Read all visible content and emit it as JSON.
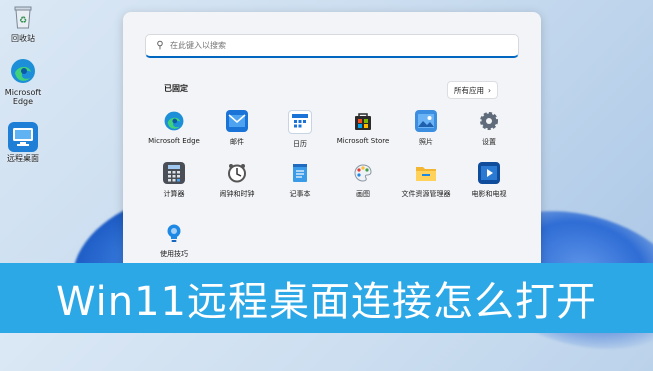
{
  "desktop": {
    "icons": [
      {
        "label": "回收站",
        "icon": "recycle-bin-icon"
      },
      {
        "label": "Microsoft Edge",
        "icon": "edge-icon"
      },
      {
        "label": "远程桌面",
        "icon": "remote-desktop-icon"
      }
    ]
  },
  "start_menu": {
    "search_placeholder": "在此键入以搜索",
    "pinned_title": "已固定",
    "all_apps_label": "所有应用",
    "apps": [
      {
        "label": "Microsoft Edge",
        "icon": "edge-icon"
      },
      {
        "label": "邮件",
        "icon": "mail-icon"
      },
      {
        "label": "日历",
        "icon": "calendar-icon"
      },
      {
        "label": "Microsoft Store",
        "icon": "store-icon"
      },
      {
        "label": "照片",
        "icon": "photos-icon"
      },
      {
        "label": "设置",
        "icon": "settings-icon"
      },
      {
        "label": "计算器",
        "icon": "calculator-icon"
      },
      {
        "label": "闹钟和时钟",
        "icon": "clock-icon"
      },
      {
        "label": "记事本",
        "icon": "notepad-icon"
      },
      {
        "label": "画图",
        "icon": "paint-icon"
      },
      {
        "label": "文件资源管理器",
        "icon": "file-explorer-icon"
      },
      {
        "label": "电影和电视",
        "icon": "movies-tv-icon"
      },
      {
        "label": "使用技巧",
        "icon": "tips-icon"
      }
    ]
  },
  "banner": {
    "text": "Win11远程桌面连接怎么打开"
  },
  "colors": {
    "accent": "#0067c0",
    "banner": "#2da8e6"
  }
}
